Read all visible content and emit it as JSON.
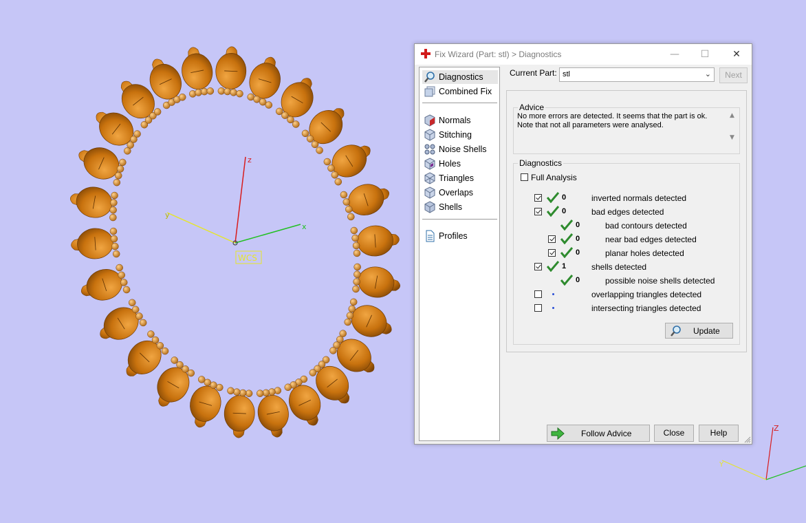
{
  "viewport": {
    "axis_labels": {
      "z": "z",
      "x": "x",
      "y": "y"
    },
    "wcs_label": "WCS",
    "mini_axis_label": "Z"
  },
  "window": {
    "title": "Fix Wizard (Part: stl) > Diagnostics",
    "minimize": "—",
    "maximize": "☐",
    "close": "✕"
  },
  "nav": {
    "items_top": [
      {
        "label": "Diagnostics",
        "icon": "magnifier-icon",
        "selected": true
      },
      {
        "label": "Combined Fix",
        "icon": "combined-fix-icon"
      }
    ],
    "items_mid": [
      {
        "label": "Normals",
        "icon": "normals-cube-icon"
      },
      {
        "label": "Stitching",
        "icon": "stitching-cube-icon"
      },
      {
        "label": "Noise Shells",
        "icon": "noise-shells-icon"
      },
      {
        "label": "Holes",
        "icon": "holes-cube-icon"
      },
      {
        "label": "Triangles",
        "icon": "triangles-cube-icon"
      },
      {
        "label": "Overlaps",
        "icon": "overlaps-cube-icon"
      },
      {
        "label": "Shells",
        "icon": "shells-cube-icon"
      }
    ],
    "items_bottom": [
      {
        "label": "Profiles",
        "icon": "profiles-document-icon"
      }
    ]
  },
  "current_part": {
    "label": "Current Part:",
    "value": "stl",
    "next_button": "Next"
  },
  "advice": {
    "title": "Advice",
    "line1": "No more errors are detected. It seems that the part is ok.",
    "line2": "Note that not all parameters were analysed."
  },
  "diagnostics": {
    "title": "Diagnostics",
    "full_analysis": {
      "label": "Full Analysis",
      "checked": false
    },
    "rows": [
      {
        "checkbox": true,
        "checked": true,
        "status": "ok",
        "count": "0",
        "label": "inverted normals detected",
        "indent": 0
      },
      {
        "checkbox": true,
        "checked": true,
        "status": "ok",
        "count": "0",
        "label": "bad edges detected",
        "indent": 0
      },
      {
        "checkbox": false,
        "checked": false,
        "status": "ok",
        "count": "0",
        "label": "bad contours detected",
        "indent": 1
      },
      {
        "checkbox": true,
        "checked": true,
        "status": "ok",
        "count": "0",
        "label": "near bad edges detected",
        "indent": 1
      },
      {
        "checkbox": true,
        "checked": true,
        "status": "ok",
        "count": "0",
        "label": "planar holes detected",
        "indent": 1
      },
      {
        "checkbox": true,
        "checked": true,
        "status": "ok",
        "count": "1",
        "label": "shells detected",
        "indent": 0
      },
      {
        "checkbox": false,
        "checked": false,
        "status": "ok",
        "count": "0",
        "label": "possible noise shells detected",
        "indent": 1
      },
      {
        "checkbox": true,
        "checked": false,
        "status": "unknown",
        "count": "",
        "label": "overlapping triangles detected",
        "indent": 0
      },
      {
        "checkbox": true,
        "checked": false,
        "status": "unknown",
        "count": "",
        "label": "intersecting triangles detected",
        "indent": 0
      }
    ],
    "update_button": "Update"
  },
  "footer": {
    "follow_advice": "Follow Advice",
    "close": "Close",
    "help": "Help"
  },
  "colors": {
    "background": "#c6c6f7",
    "part": "#c8720e",
    "tick_green": "#2e8b2e",
    "axis_x": "#22c022",
    "axis_y": "#e6e62a",
    "axis_z": "#d81c1c"
  }
}
